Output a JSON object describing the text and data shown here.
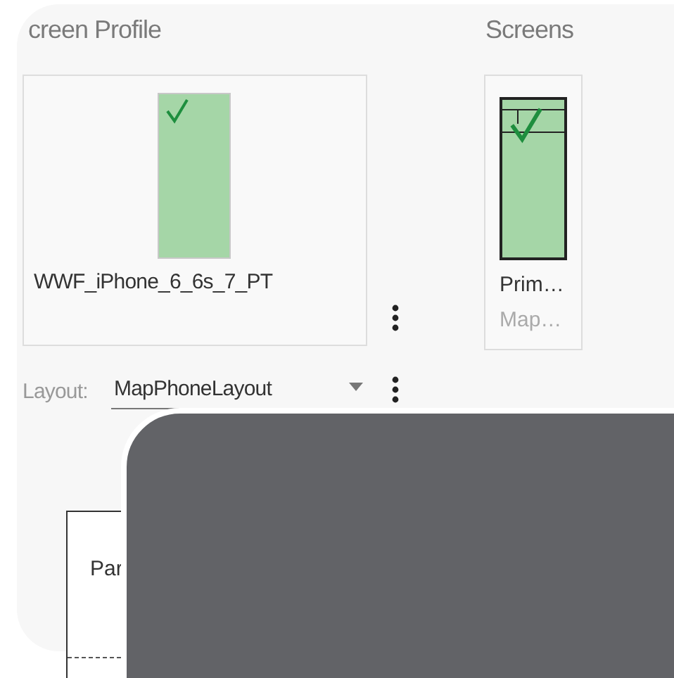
{
  "screen_profile": {
    "heading": "creen Profile",
    "profile": {
      "name": "WWF_iPhone_6_6s_7_PT",
      "selected": true
    }
  },
  "screens": {
    "heading": "Screens",
    "items": [
      {
        "name": "Prim…",
        "layout": "Map…",
        "selected": true
      }
    ]
  },
  "layout": {
    "label": "Layout:",
    "value": "MapPhoneLayout"
  },
  "preview": {
    "label": "Par"
  }
}
